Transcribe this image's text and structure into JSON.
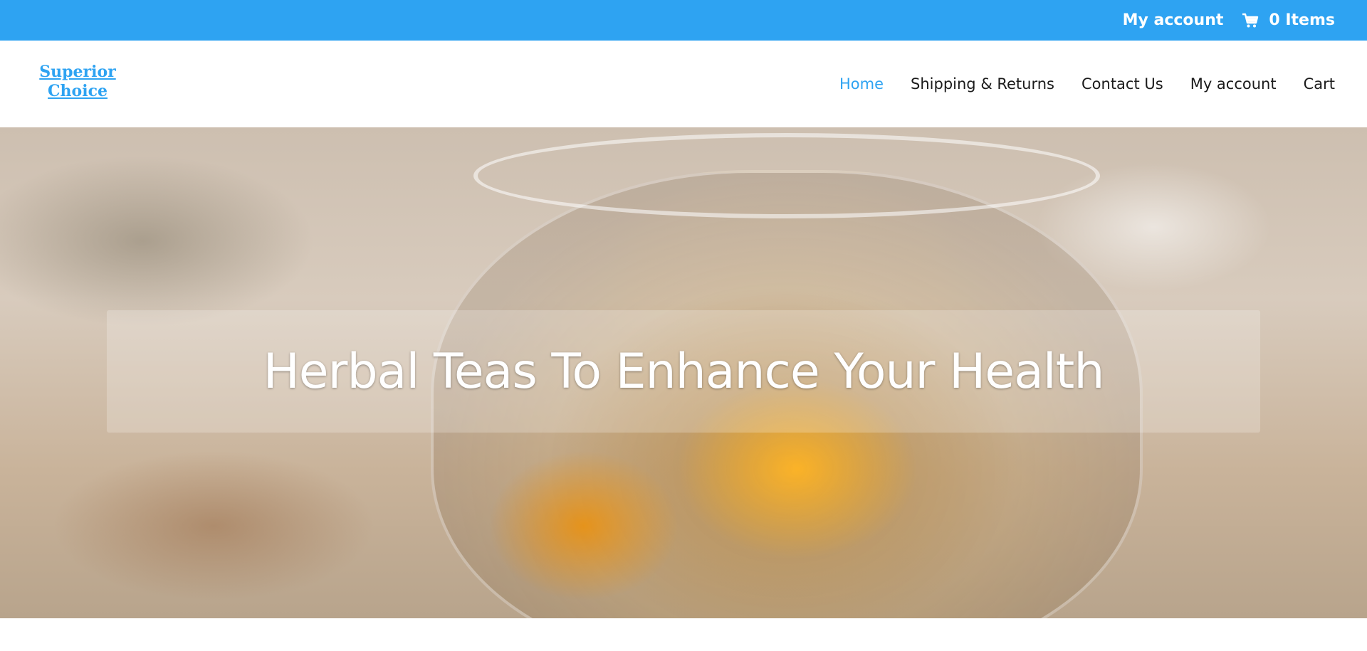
{
  "top_bar": {
    "account_label": "My account",
    "cart_label": "0 Items",
    "background_color": "#2ea3f2"
  },
  "header": {
    "logo": {
      "line1": "Superior",
      "line2": "Choice"
    },
    "nav": [
      {
        "label": "Home",
        "active": true
      },
      {
        "label": "Shipping & Returns",
        "active": false
      },
      {
        "label": "Contact Us",
        "active": false
      },
      {
        "label": "My account",
        "active": false
      },
      {
        "label": "Cart",
        "active": false
      }
    ],
    "accent_color": "#2ea3f2"
  },
  "hero": {
    "title": "Herbal Teas To Enhance Your Health"
  },
  "icons": {
    "cart": "cart-icon"
  }
}
